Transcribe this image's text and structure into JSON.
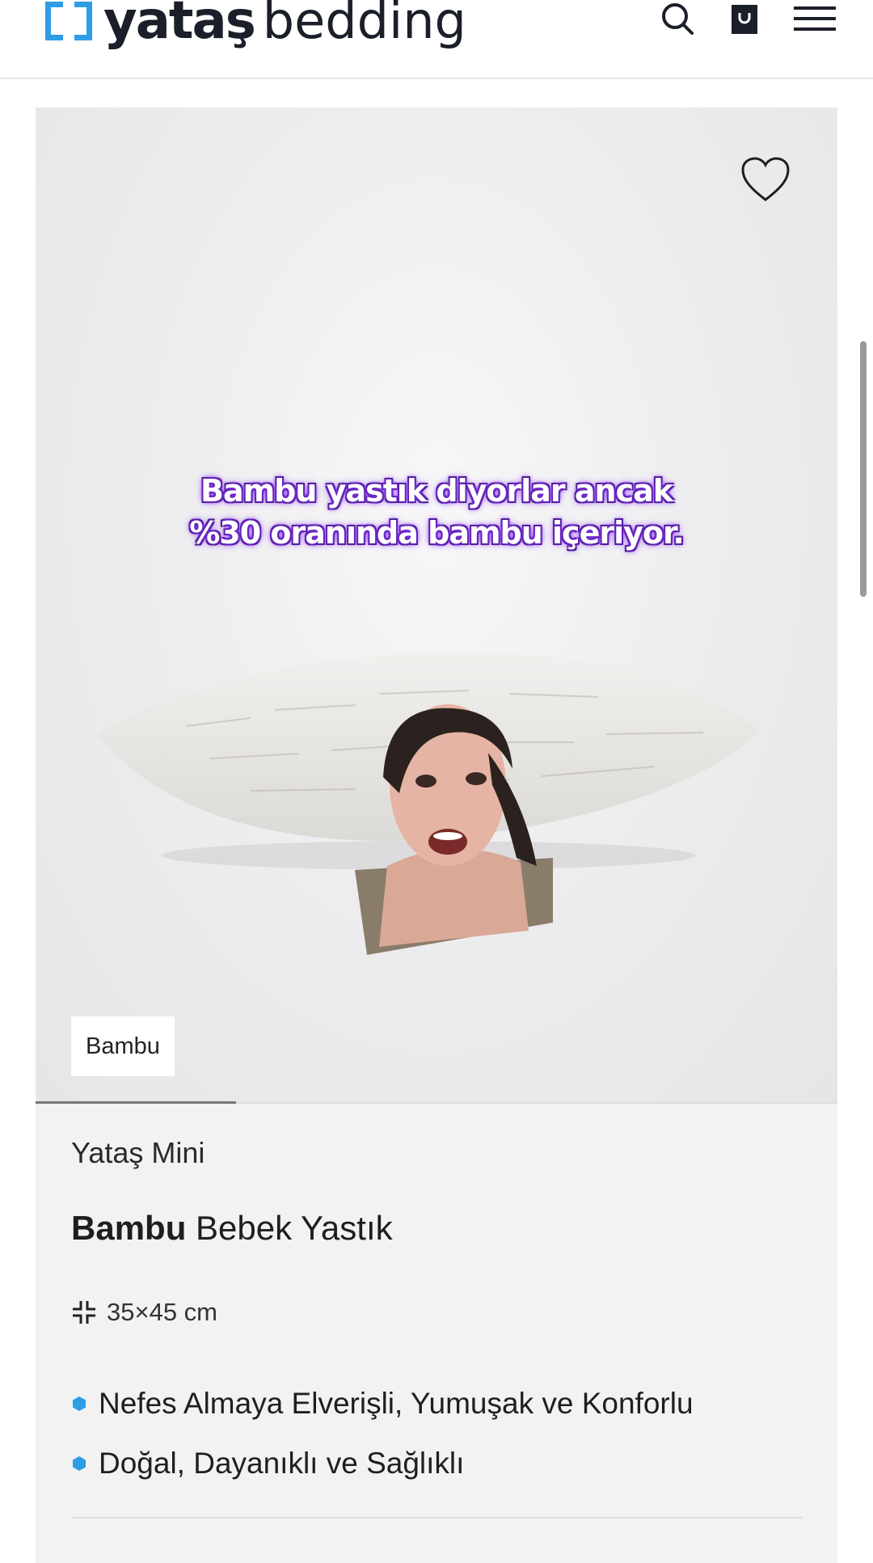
{
  "header": {
    "logo_brand": "yataş",
    "logo_sub": "bedding",
    "icons": [
      "search-icon",
      "shopping-bag-icon",
      "menu-icon"
    ]
  },
  "product": {
    "caption_line1": "Bambu yastık diyorlar ancak",
    "caption_line2": "%30 oranında bambu içeriyor.",
    "tag": "Bambu",
    "brand_line": "Yataş Mini",
    "title_bold": "Bambu",
    "title_rest": " Bebek Yastık",
    "size": "35×45 cm",
    "features": [
      "Nefes Almaya Elverişli, Yumuşak ve Konforlu",
      "Doğal, Dayanıklı ve Sağlıklı"
    ]
  },
  "colors": {
    "accent": "#2d9de6",
    "caption_glow": "#9b4dff"
  }
}
